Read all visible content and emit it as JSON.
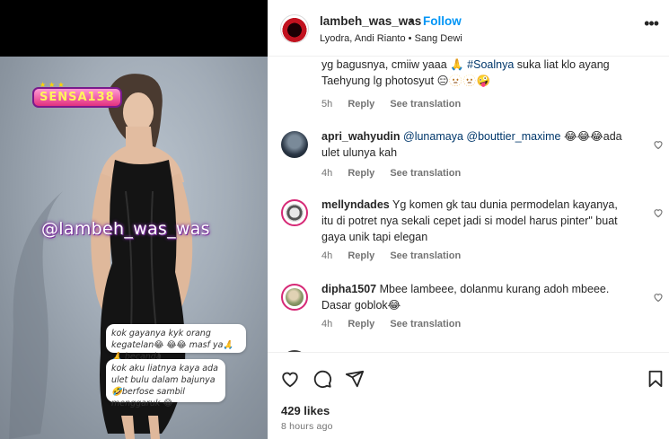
{
  "post": {
    "username": "lambeh_was_was",
    "follow_label": "Follow",
    "separator": "•",
    "music_line": "Lyodra, Andi Rianto • Sang Dewi",
    "likes": "429 likes",
    "time_ago": "8 hours ago"
  },
  "media": {
    "watermark_logo": "SENSA138",
    "watermark_handle": "@lambeh_was_was",
    "bubble_1": "kok gayanya kyk orang kegatelan😂 😂😂 masf ya🙏🙏 becanda",
    "bubble_2": "kok aku liatnya kaya ada ulet bulu dalam bajunya🤣berfose sambil menggaruk 😂"
  },
  "comments": [
    {
      "user": "",
      "text_1": "yg bagusnya, cmiiw yaaa 🙏 ",
      "hashtag": "#Soalnya",
      "text_2": " suka liat klo ayang Taehyung lg photosyut 😑🫥🫥🤪",
      "time": "5h",
      "reply": "Reply",
      "see_translation": "See translation"
    },
    {
      "user": "apri_wahyudin",
      "mention_1": "@lunamaya",
      "mention_2": "@bouttier_maxime",
      "text": " 😂😂😂ada ulet ulunya kah",
      "time": "4h",
      "reply": "Reply",
      "see_translation": "See translation"
    },
    {
      "user": "mellyndades",
      "text": " Yg komen gk tau dunia permodelan kayanya, itu di potret nya sekali cepet jadi si model harus pinter\" buat gaya unik tapi elegan",
      "time": "4h",
      "reply": "Reply",
      "see_translation": "See translation"
    },
    {
      "user": "dipha1507",
      "text": " Mbee lambeee, dolanmu kurang adoh mbeee. Dasar goblok😂",
      "time": "4h",
      "reply": "Reply",
      "see_translation": "See translation"
    }
  ],
  "colors": {
    "follow_blue": "#0095f6",
    "mention_blue": "#00376b",
    "meta_gray": "#737373"
  },
  "icons": [
    "like-heart-icon",
    "comment-icon",
    "share-icon",
    "save-bookmark-icon",
    "more-options-icon"
  ]
}
